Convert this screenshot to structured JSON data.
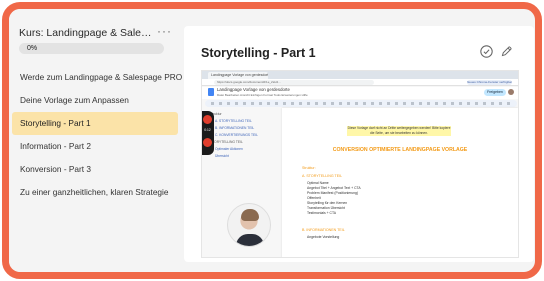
{
  "sidebar": {
    "course_title": "Kurs: Landingpage & Salespage ...",
    "progress_percent": 0,
    "progress_label": "0%",
    "more_icon": "more-horizontal-icon",
    "lessons": [
      {
        "label": "Werde zum Landingpage & Salespage PRO",
        "active": false
      },
      {
        "label": "Deine Vorlage zum Anpassen",
        "active": false
      },
      {
        "label": "Storytelling - Part 1",
        "active": true
      },
      {
        "label": "Information - Part 2",
        "active": false
      },
      {
        "label": "Konversion - Part 3",
        "active": false
      },
      {
        "label": "Zu einer ganzheitlichen, klaren Strategie",
        "active": false
      }
    ]
  },
  "main": {
    "title": "Storytelling - Part 1",
    "icons": [
      "check-circle-icon",
      "pencil-icon"
    ]
  },
  "video": {
    "browser_tab": "Landingpage Vorlage von gerdesdorte",
    "url": "https://docs.google.com/document/d/1e_2sH4...",
    "url_pill": "Neues Chrome-Fenster verfügbar",
    "doc_name": "Landingpage Vorlage von gerdesdorte",
    "doc_menu": "Datei  Bearbeiten  Ansicht  Einfügen  Format  Tools  Erweiterungen  Hilfe",
    "share_label": "Freigeben",
    "recording_time": "0:12",
    "outline": [
      {
        "text": "Struktur",
        "sub": false
      },
      {
        "text": "A. STORYTELLING TEIL",
        "sub": true
      },
      {
        "text": "B. INFORMATIONEN TEIL",
        "sub": true
      },
      {
        "text": "C. KONVERTIERUNGS TEIL",
        "sub": true
      },
      {
        "text": "STORYTELLING TEIL",
        "sub": false
      },
      {
        "text": "Optimaler Aktionen",
        "sub": false
      },
      {
        "text": "Übersicht",
        "sub": false
      }
    ],
    "doc_note": "Diese Vorlage darf nicht an Dritte weitergegeben werden! Bitte kopiere die Seite, um sie bearbeiten zu können.",
    "doc_headline": "CONVERSION OPTIMIERTE LANDINGPAGE VORLAGE",
    "doc_section_struktur": "Struktur:",
    "doc_section_a": "A. STORYTELLING TEIL",
    "doc_items_a": [
      "Optimal Name",
      "Angebot Titel + Angebot Text + CTA",
      "Problem Manifest (Positionierung)",
      "Offenheit",
      "Storytelling für den Kernen",
      "Transformation Übersicht",
      "Testimonials + CTA"
    ],
    "doc_section_b": "B. INFORMATIONEN TEIL",
    "doc_items_b": [
      "Angebote Vorstellung"
    ]
  }
}
